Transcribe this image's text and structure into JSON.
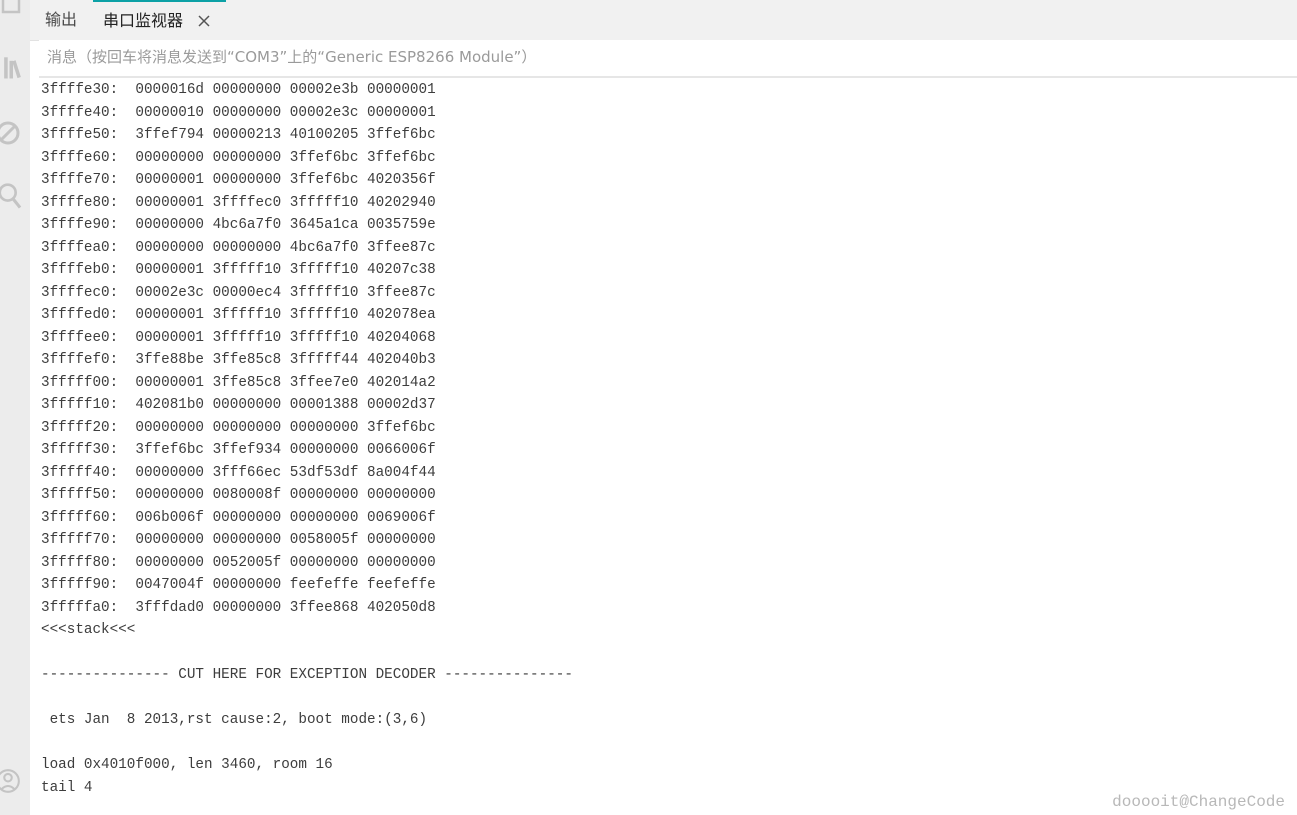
{
  "tabs": [
    {
      "label": "输出"
    },
    {
      "label": "串口监视器",
      "active": true
    }
  ],
  "message": {
    "placeholder": "消息（按回车将消息发送到“COM3”上的“Generic ESP8266 Module”）",
    "value": ""
  },
  "output_lines": [
    "3ffffe30:  0000016d 00000000 00002e3b 00000001",
    "3ffffe40:  00000010 00000000 00002e3c 00000001",
    "3ffffe50:  3ffef794 00000213 40100205 3ffef6bc",
    "3ffffe60:  00000000 00000000 3ffef6bc 3ffef6bc",
    "3ffffe70:  00000001 00000000 3ffef6bc 4020356f",
    "3ffffe80:  00000001 3ffffec0 3fffff10 40202940",
    "3ffffe90:  00000000 4bc6a7f0 3645a1ca 0035759e",
    "3ffffea0:  00000000 00000000 4bc6a7f0 3ffee87c",
    "3ffffeb0:  00000001 3fffff10 3fffff10 40207c38",
    "3ffffec0:  00002e3c 00000ec4 3fffff10 3ffee87c",
    "3ffffed0:  00000001 3fffff10 3fffff10 402078ea",
    "3ffffee0:  00000001 3fffff10 3fffff10 40204068",
    "3ffffef0:  3ffe88be 3ffe85c8 3fffff44 402040b3",
    "3fffff00:  00000001 3ffe85c8 3ffee7e0 402014a2",
    "3fffff10:  402081b0 00000000 00001388 00002d37",
    "3fffff20:  00000000 00000000 00000000 3ffef6bc",
    "3fffff30:  3ffef6bc 3ffef934 00000000 0066006f",
    "3fffff40:  00000000 3fff66ec 53df53df 8a004f44",
    "3fffff50:  00000000 0080008f 00000000 00000000",
    "3fffff60:  006b006f 00000000 00000000 0069006f",
    "3fffff70:  00000000 00000000 0058005f 00000000",
    "3fffff80:  00000000 0052005f 00000000 00000000",
    "3fffff90:  0047004f 00000000 feefeffe feefeffe",
    "3fffffa0:  3fffdad0 00000000 3ffee868 402050d8",
    "<<<stack<<<",
    "",
    "--------------- CUT HERE FOR EXCEPTION DECODER ---------------",
    "",
    " ets Jan  8 2013,rst cause:2, boot mode:(3,6)",
    "",
    "load 0x4010f000, len 3460, room 16",
    "tail 4"
  ],
  "watermark": "dooooit@ChangeCode",
  "colors": {
    "accent": "#0ca1a6",
    "text": "#3d3d3d",
    "icon": "#c4c4c4"
  },
  "icons": {
    "activity": [
      "files-icon",
      "library-icon",
      "debug-icon",
      "search-icon",
      "account-icon"
    ],
    "tab_close": "close-icon"
  }
}
